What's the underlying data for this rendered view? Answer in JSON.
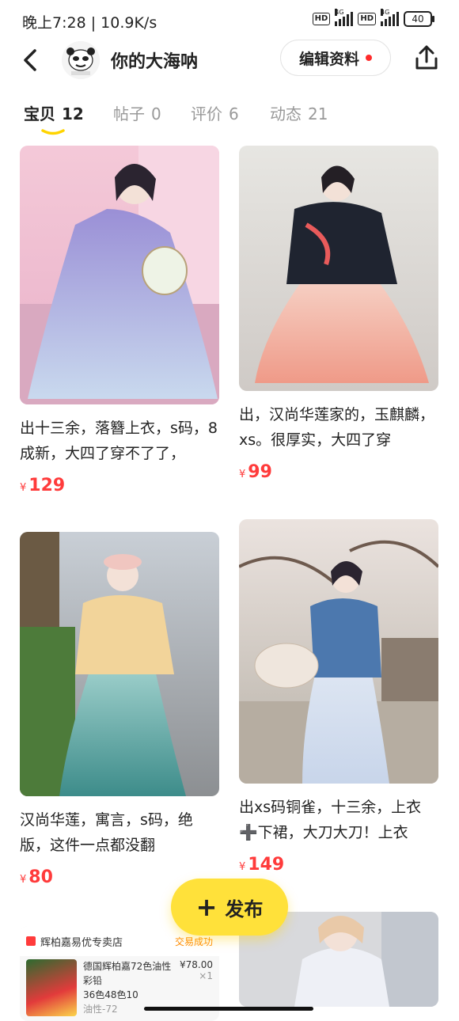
{
  "status_bar": {
    "time": "晚上7:28 | 10.9K/s",
    "hd1": "HD",
    "hd2": "HD",
    "net1": "4G",
    "net2": "4G",
    "battery": "40"
  },
  "header": {
    "shop_name": "你的大海呐",
    "edit_button": "编辑资料"
  },
  "tabs": [
    {
      "label": "宝贝",
      "count": "12",
      "active": true
    },
    {
      "label": "帖子",
      "count": "0",
      "active": false
    },
    {
      "label": "评价",
      "count": "6",
      "active": false
    },
    {
      "label": "动态",
      "count": "21",
      "active": false
    }
  ],
  "items": [
    {
      "title": "出十三余，落簪上衣，s码，8成新，大四了穿不了了，",
      "currency": "¥",
      "price": "129"
    },
    {
      "title": "出，汉尚华莲家的，玉麒麟，xs。很厚实，大四了穿",
      "currency": "¥",
      "price": "99"
    },
    {
      "title": "汉尚华莲，寓言，s码，绝版，这件一点都没翻",
      "currency": "¥",
      "price": "80"
    },
    {
      "title": "出xs码铜雀，十三余，上衣➕下裙，大刀大刀！上衣",
      "currency": "¥",
      "price": "149"
    }
  ],
  "partial_store": {
    "name": "辉柏嘉易优专卖店",
    "status": "交易成功",
    "desc_line1": "德国辉柏嘉72色油性彩铅",
    "desc_line2": "36色48色10",
    "desc_line3": "油性-72",
    "price": "¥78.00",
    "qty": "×1"
  },
  "publish_button": {
    "icon": "plus-icon",
    "label": "发布"
  },
  "colors": {
    "accent_yellow": "#ffe13a",
    "price_red": "#ff3b3b",
    "tab_underline": "#ffd400"
  }
}
